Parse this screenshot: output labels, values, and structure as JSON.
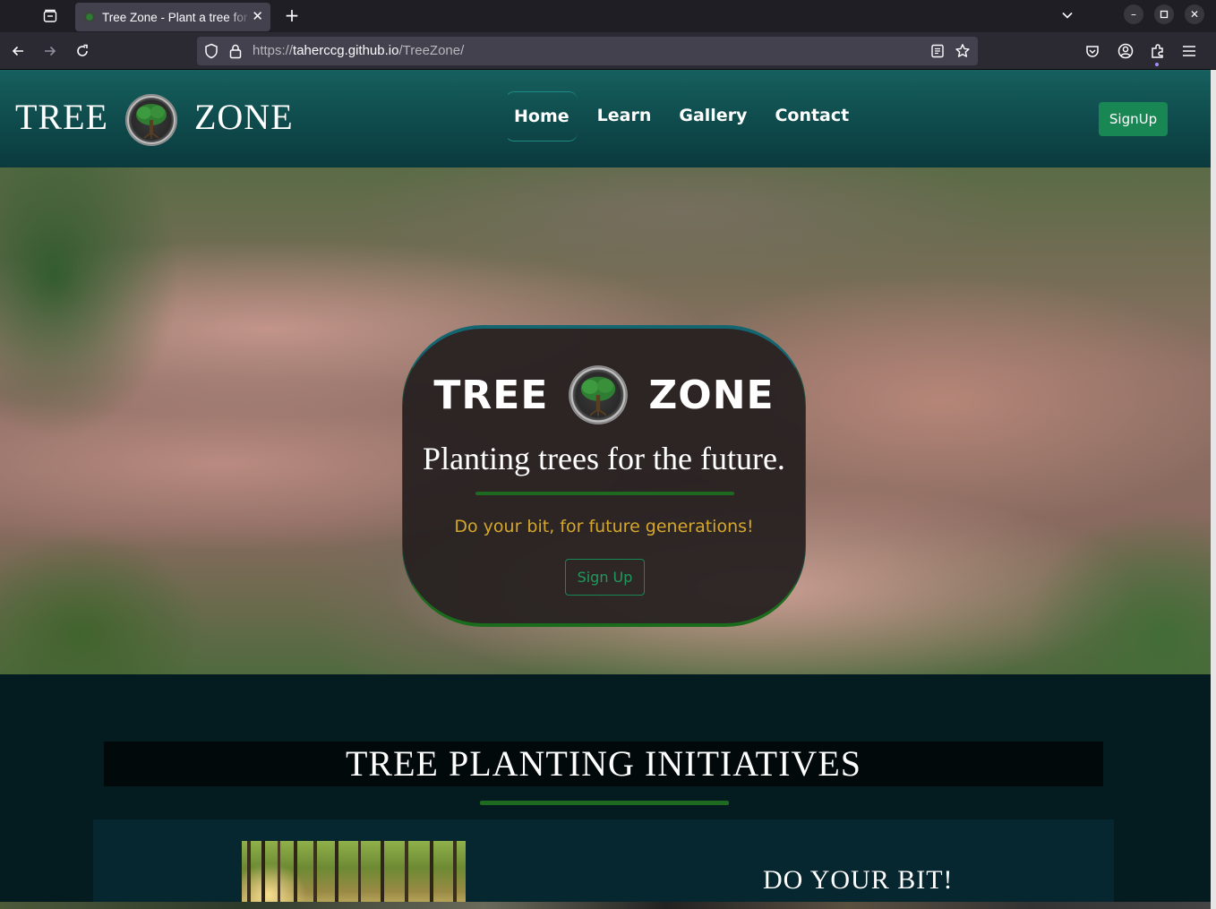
{
  "browser": {
    "tab_title": "Tree Zone - Plant a tree for the future",
    "url_prefix": "https://",
    "url_host": "taherccg.github.io",
    "url_path": "/TreeZone/",
    "icons": {
      "tab_overview": "tab-overview-icon",
      "back": "back-arrow-icon",
      "forward": "forward-arrow-icon",
      "reload": "reload-icon",
      "shield": "tracking-protection-shield-icon",
      "lock": "lock-icon",
      "reader": "reader-view-icon",
      "bookmark": "star-icon",
      "pocket": "pocket-icon",
      "account": "account-icon",
      "extensions": "extensions-icon",
      "menu": "hamburger-menu-icon"
    }
  },
  "header": {
    "brand_left": "TREE",
    "brand_right": "ZONE",
    "nav": [
      "Home",
      "Learn",
      "Gallery",
      "Contact"
    ],
    "active_nav": "Home",
    "signup_label": "SignUp"
  },
  "hero": {
    "brand_left": "TREE",
    "brand_right": "ZONE",
    "tagline": "Planting trees for the future.",
    "subtitle": "Do your bit, for future generations!",
    "button_label": "Sign Up"
  },
  "initiatives": {
    "title": "TREE PLANTING INITIATIVES",
    "card_heading": "DO YOUR BIT!"
  },
  "colors": {
    "header_teal": "#0f4c4d",
    "signup_green": "#198754",
    "subtitle_gold": "#d4a72c",
    "page_dark": "#041c20"
  }
}
